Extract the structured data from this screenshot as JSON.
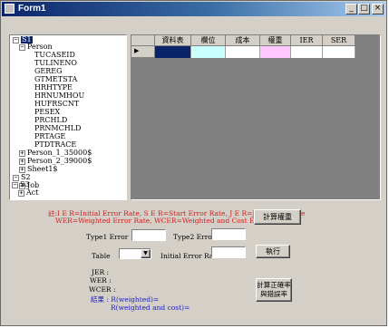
{
  "window": {
    "title": "Form1",
    "min": "_",
    "max": "□",
    "close": "×"
  },
  "tree": {
    "root1": "S1",
    "person": "Person",
    "fields": [
      "TUCASEID",
      "TULINENO",
      "GEREG",
      "GTMETSTA",
      "HRHTYPE",
      "HRNUMHOU",
      "HUFRSCNT",
      "PESEX",
      "PRCHLD",
      "PRNMCHLD",
      "PRTAGE",
      "PTDTRACE"
    ],
    "person1": "Person_1_35000$",
    "person2": "Person_2_39000$",
    "sheet1": "Sheet1$",
    "root2": "S2",
    "job": "Job",
    "root3": "S3",
    "act": "Act"
  },
  "grid": {
    "columns": [
      "資料表",
      "欄位",
      "成本",
      "權重",
      "IER",
      "SER"
    ],
    "row_pointer": "▶",
    "cell_colors": [
      "#0a246a",
      "#c8ffff",
      "#ffffff",
      "#ffc8ff",
      "#ffffff",
      "#ffffff"
    ]
  },
  "notes": {
    "line1": "註:I E R=Initial Error Rate,      S E R=Start Error Rate,  J E R=Join Error Rate",
    "line2": "WER=Weighted Error Rate, WCER=Weighted and Cost Error Rate"
  },
  "buttons": {
    "compute_weight": "計算權重",
    "execute": "執行",
    "compute_accuracy": "計算正確率\n與錯誤率"
  },
  "form": {
    "type1_label": "Type1 Error",
    "type2_label": "Type2 Error",
    "table_label": "Table",
    "initial_error_label": "Initial Error Rate",
    "type1_value": "",
    "type2_value": "",
    "table_value": "",
    "initial_error_value": ""
  },
  "results": {
    "jer": "JER :",
    "wer": "WER :",
    "wcer": "WCER :",
    "weighted": "結果 : R(weighted)=",
    "weighted_cost": "R(weighted and cost)="
  }
}
